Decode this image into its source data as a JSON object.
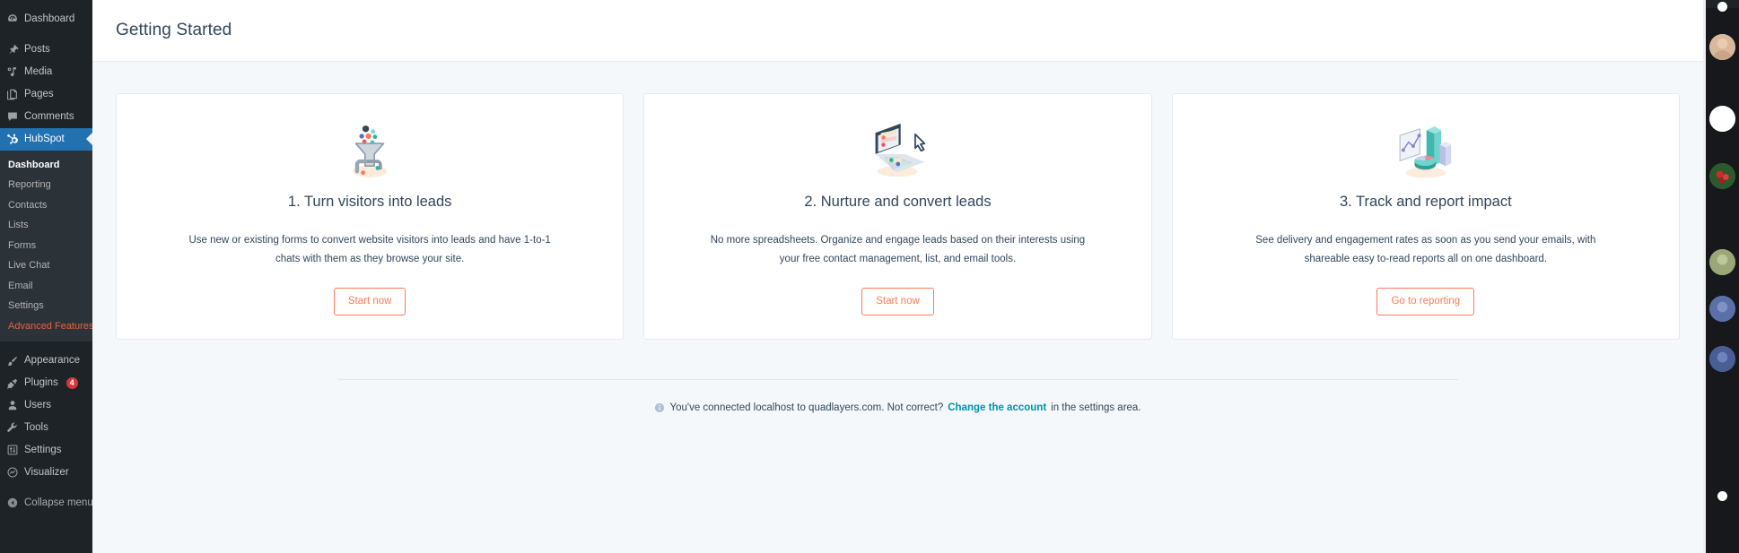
{
  "sidebar": {
    "items": [
      {
        "label": "Dashboard",
        "icon": "dashboard-icon"
      },
      {
        "label": "Posts",
        "icon": "pin-icon"
      },
      {
        "label": "Media",
        "icon": "media-icon"
      },
      {
        "label": "Pages",
        "icon": "pages-icon"
      },
      {
        "label": "Comments",
        "icon": "comments-icon"
      },
      {
        "label": "HubSpot",
        "icon": "hubspot-icon",
        "current": true
      }
    ],
    "submenu": [
      {
        "label": "Dashboard",
        "current": true
      },
      {
        "label": "Reporting"
      },
      {
        "label": "Contacts"
      },
      {
        "label": "Lists"
      },
      {
        "label": "Forms"
      },
      {
        "label": "Live Chat"
      },
      {
        "label": "Email"
      },
      {
        "label": "Settings"
      },
      {
        "label": "Advanced Features",
        "accent": true
      }
    ],
    "items_bottom": [
      {
        "label": "Appearance",
        "icon": "brush-icon"
      },
      {
        "label": "Plugins",
        "icon": "plug-icon",
        "badge": "4"
      },
      {
        "label": "Users",
        "icon": "user-icon"
      },
      {
        "label": "Tools",
        "icon": "wrench-icon"
      },
      {
        "label": "Settings",
        "icon": "settings-icon"
      },
      {
        "label": "Visualizer",
        "icon": "chart-circle-icon"
      }
    ],
    "collapse_label": "Collapse menu",
    "accent_color": "#2271b1",
    "advanced_color": "#e8603c",
    "badge_color": "#d63638"
  },
  "header": {
    "title": "Getting Started"
  },
  "cards": [
    {
      "icon": "funnel-leads-icon",
      "title": "1. Turn visitors into leads",
      "description": "Use new or existing forms to convert website visitors into leads and have 1-to-1 chats with them as they browse your site.",
      "button": "Start now"
    },
    {
      "icon": "laptop-contacts-icon",
      "title": "2. Nurture and convert leads",
      "description": "No more spreadsheets. Organize and engage leads based on their interests using your free contact management, list, and email tools.",
      "button": "Start now"
    },
    {
      "icon": "reporting-charts-icon",
      "title": "3. Track and report impact",
      "description": "See delivery and engagement rates as soon as you send your emails, with shareable easy to-read reports all on one dashboard.",
      "button": "Go to reporting"
    }
  ],
  "footer": {
    "icon": "info-icon",
    "text_before": "You've connected localhost to quadlayers.com. Not correct?",
    "link_text": "Change the account",
    "text_after": "in the settings area."
  },
  "colors": {
    "cta": "#ff7a59",
    "link": "#0091ae",
    "text": "#33475b",
    "page_bg": "#f5f8fa"
  }
}
